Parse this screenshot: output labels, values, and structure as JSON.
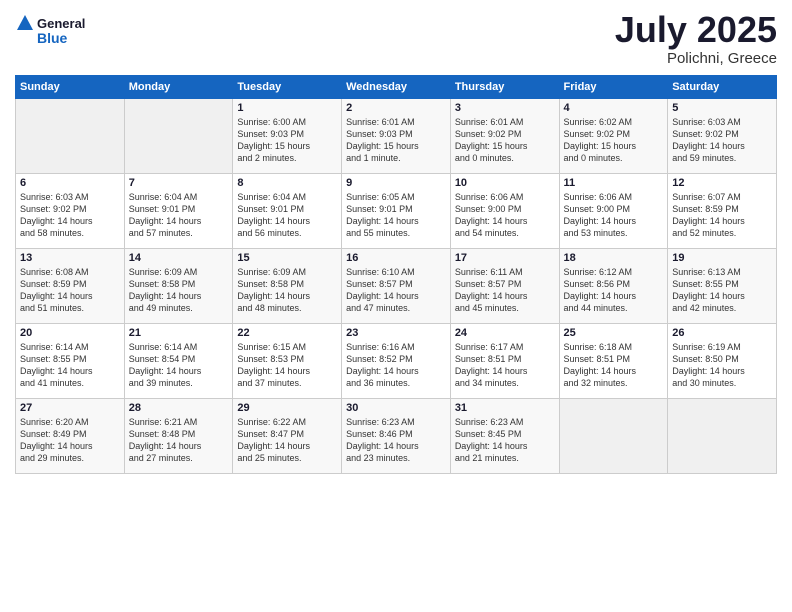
{
  "header": {
    "logo_line1": "General",
    "logo_line2": "Blue",
    "month": "July 2025",
    "location": "Polichni, Greece"
  },
  "weekdays": [
    "Sunday",
    "Monday",
    "Tuesday",
    "Wednesday",
    "Thursday",
    "Friday",
    "Saturday"
  ],
  "weeks": [
    [
      {
        "day": "",
        "info": ""
      },
      {
        "day": "",
        "info": ""
      },
      {
        "day": "1",
        "info": "Sunrise: 6:00 AM\nSunset: 9:03 PM\nDaylight: 15 hours\nand 2 minutes."
      },
      {
        "day": "2",
        "info": "Sunrise: 6:01 AM\nSunset: 9:03 PM\nDaylight: 15 hours\nand 1 minute."
      },
      {
        "day": "3",
        "info": "Sunrise: 6:01 AM\nSunset: 9:02 PM\nDaylight: 15 hours\nand 0 minutes."
      },
      {
        "day": "4",
        "info": "Sunrise: 6:02 AM\nSunset: 9:02 PM\nDaylight: 15 hours\nand 0 minutes."
      },
      {
        "day": "5",
        "info": "Sunrise: 6:03 AM\nSunset: 9:02 PM\nDaylight: 14 hours\nand 59 minutes."
      }
    ],
    [
      {
        "day": "6",
        "info": "Sunrise: 6:03 AM\nSunset: 9:02 PM\nDaylight: 14 hours\nand 58 minutes."
      },
      {
        "day": "7",
        "info": "Sunrise: 6:04 AM\nSunset: 9:01 PM\nDaylight: 14 hours\nand 57 minutes."
      },
      {
        "day": "8",
        "info": "Sunrise: 6:04 AM\nSunset: 9:01 PM\nDaylight: 14 hours\nand 56 minutes."
      },
      {
        "day": "9",
        "info": "Sunrise: 6:05 AM\nSunset: 9:01 PM\nDaylight: 14 hours\nand 55 minutes."
      },
      {
        "day": "10",
        "info": "Sunrise: 6:06 AM\nSunset: 9:00 PM\nDaylight: 14 hours\nand 54 minutes."
      },
      {
        "day": "11",
        "info": "Sunrise: 6:06 AM\nSunset: 9:00 PM\nDaylight: 14 hours\nand 53 minutes."
      },
      {
        "day": "12",
        "info": "Sunrise: 6:07 AM\nSunset: 8:59 PM\nDaylight: 14 hours\nand 52 minutes."
      }
    ],
    [
      {
        "day": "13",
        "info": "Sunrise: 6:08 AM\nSunset: 8:59 PM\nDaylight: 14 hours\nand 51 minutes."
      },
      {
        "day": "14",
        "info": "Sunrise: 6:09 AM\nSunset: 8:58 PM\nDaylight: 14 hours\nand 49 minutes."
      },
      {
        "day": "15",
        "info": "Sunrise: 6:09 AM\nSunset: 8:58 PM\nDaylight: 14 hours\nand 48 minutes."
      },
      {
        "day": "16",
        "info": "Sunrise: 6:10 AM\nSunset: 8:57 PM\nDaylight: 14 hours\nand 47 minutes."
      },
      {
        "day": "17",
        "info": "Sunrise: 6:11 AM\nSunset: 8:57 PM\nDaylight: 14 hours\nand 45 minutes."
      },
      {
        "day": "18",
        "info": "Sunrise: 6:12 AM\nSunset: 8:56 PM\nDaylight: 14 hours\nand 44 minutes."
      },
      {
        "day": "19",
        "info": "Sunrise: 6:13 AM\nSunset: 8:55 PM\nDaylight: 14 hours\nand 42 minutes."
      }
    ],
    [
      {
        "day": "20",
        "info": "Sunrise: 6:14 AM\nSunset: 8:55 PM\nDaylight: 14 hours\nand 41 minutes."
      },
      {
        "day": "21",
        "info": "Sunrise: 6:14 AM\nSunset: 8:54 PM\nDaylight: 14 hours\nand 39 minutes."
      },
      {
        "day": "22",
        "info": "Sunrise: 6:15 AM\nSunset: 8:53 PM\nDaylight: 14 hours\nand 37 minutes."
      },
      {
        "day": "23",
        "info": "Sunrise: 6:16 AM\nSunset: 8:52 PM\nDaylight: 14 hours\nand 36 minutes."
      },
      {
        "day": "24",
        "info": "Sunrise: 6:17 AM\nSunset: 8:51 PM\nDaylight: 14 hours\nand 34 minutes."
      },
      {
        "day": "25",
        "info": "Sunrise: 6:18 AM\nSunset: 8:51 PM\nDaylight: 14 hours\nand 32 minutes."
      },
      {
        "day": "26",
        "info": "Sunrise: 6:19 AM\nSunset: 8:50 PM\nDaylight: 14 hours\nand 30 minutes."
      }
    ],
    [
      {
        "day": "27",
        "info": "Sunrise: 6:20 AM\nSunset: 8:49 PM\nDaylight: 14 hours\nand 29 minutes."
      },
      {
        "day": "28",
        "info": "Sunrise: 6:21 AM\nSunset: 8:48 PM\nDaylight: 14 hours\nand 27 minutes."
      },
      {
        "day": "29",
        "info": "Sunrise: 6:22 AM\nSunset: 8:47 PM\nDaylight: 14 hours\nand 25 minutes."
      },
      {
        "day": "30",
        "info": "Sunrise: 6:23 AM\nSunset: 8:46 PM\nDaylight: 14 hours\nand 23 minutes."
      },
      {
        "day": "31",
        "info": "Sunrise: 6:23 AM\nSunset: 8:45 PM\nDaylight: 14 hours\nand 21 minutes."
      },
      {
        "day": "",
        "info": ""
      },
      {
        "day": "",
        "info": ""
      }
    ]
  ]
}
